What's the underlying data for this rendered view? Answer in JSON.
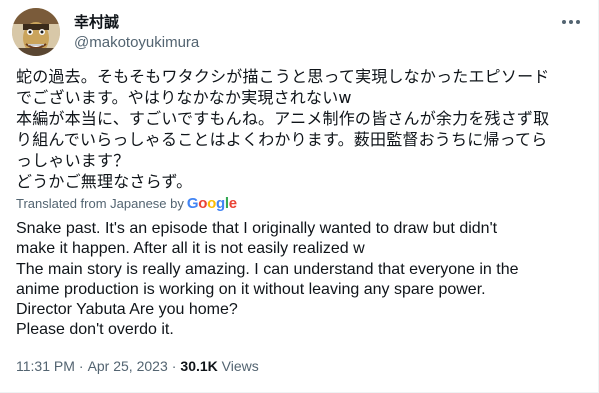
{
  "author": {
    "display_name": "幸村誠",
    "handle": "@makotoyukimura",
    "avatar_icon": "avatar-illustration"
  },
  "more_icon": "more-horizontal-icon",
  "original_text": [
    "蛇の過去。そもそもワタクシが描こうと思って実現しなかったエピソード",
    "でございます。やはりなかなか実現されないw",
    "本編が本当に、すごいですもんね。アニメ制作の皆さんが余力を残さず取",
    "り組んでいらっしゃることはよくわかります。薮田監督おうちに帰ってら",
    "っしゃいます？",
    "どうかご無理なさらず。"
  ],
  "translation": {
    "label": "Translated from Japanese by",
    "brand": [
      "G",
      "o",
      "o",
      "g",
      "l",
      "e"
    ],
    "lines": [
      "Snake past. It's an episode that I originally wanted to draw but didn't",
      "make it happen. After all it is not easily realized w",
      "The main story is really amazing. I can understand that everyone in the",
      "anime production is working on it without leaving any spare power.",
      "Director Yabuta Are you home?",
      "Please don't overdo it."
    ]
  },
  "meta": {
    "time": "11:31 PM",
    "separator": "·",
    "date": "Apr 25, 2023",
    "views_count": "30.1K",
    "views_label": "Views"
  },
  "colors": {
    "text": "#0f1419",
    "secondary": "#536471",
    "google_blue": "#4285f4",
    "google_red": "#ea4335",
    "google_yellow": "#fbbc05",
    "google_green": "#34a853"
  }
}
